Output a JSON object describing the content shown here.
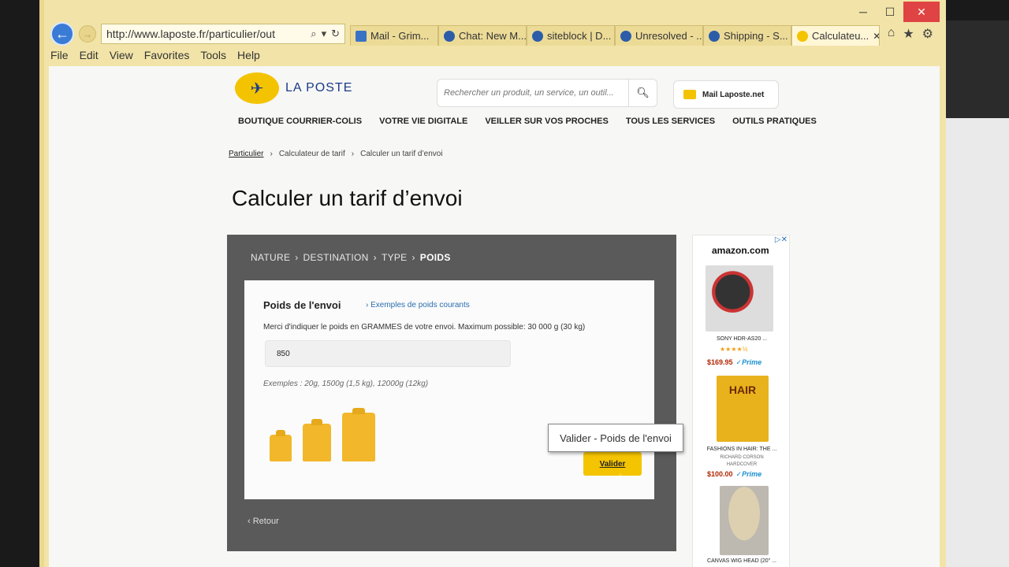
{
  "browser": {
    "address_url": "http://www.laposte.fr/particulier/out",
    "menu": [
      "File",
      "Edit",
      "View",
      "Favorites",
      "Tools",
      "Help"
    ],
    "tabs": [
      {
        "label": "Mail - Grim..."
      },
      {
        "label": "Chat: New M..."
      },
      {
        "label": "siteblock | D..."
      },
      {
        "label": "Unresolved - ..."
      },
      {
        "label": "Shipping - S..."
      },
      {
        "label": "Calculateu..."
      }
    ]
  },
  "site": {
    "logo_text": "LA POSTE",
    "search_placeholder": "Rechercher un produit, un service, un outil...",
    "mail_button": "Mail Laposte.net",
    "nav": [
      "BOUTIQUE COURRIER-COLIS",
      "VOTRE VIE DIGITALE",
      "VEILLER SUR VOS PROCHES",
      "TOUS LES SERVICES",
      "OUTILS PRATIQUES"
    ],
    "breadcrumb": [
      "Particulier",
      "Calculateur de tarif",
      "Calculer un tarif d’envoi"
    ],
    "page_title": "Calculer un tarif d’envoi"
  },
  "calculator": {
    "steps": [
      "NATURE",
      "DESTINATION",
      "TYPE",
      "POIDS"
    ],
    "section_title": "Poids de l'envoi",
    "examples_link": "Exemples de poids courants",
    "hint": "Merci d'indiquer le poids en GRAMMES de votre envoi. Maximum possible: 30 000 g (30 kg)",
    "weight_value": "850",
    "examples": "Exemples : 20g, 1500g (1,5 kg), 12000g (12kg)",
    "submit_label": "Valider",
    "tooltip": "Valider - Poids de l'envoi",
    "back_label": "Retour"
  },
  "ad": {
    "brand": "amazon.com",
    "items": [
      {
        "name": "SONY HDR-AS20 ...",
        "stars": "★★★★½",
        "price": "$169.95",
        "prime": "✓Prime"
      },
      {
        "name": "FASHIONS IN HAIR: THE ...",
        "author": "RICHARD CORSON",
        "format": "HARDCOVER",
        "price": "$100.00",
        "prime": "✓Prime"
      },
      {
        "name": "CANVAS WIG HEAD (20\" ..."
      }
    ]
  },
  "colors": {
    "brand_yellow": "#f5c400",
    "panel_gray": "#5a5a5a",
    "link_blue": "#2a6fb0"
  }
}
